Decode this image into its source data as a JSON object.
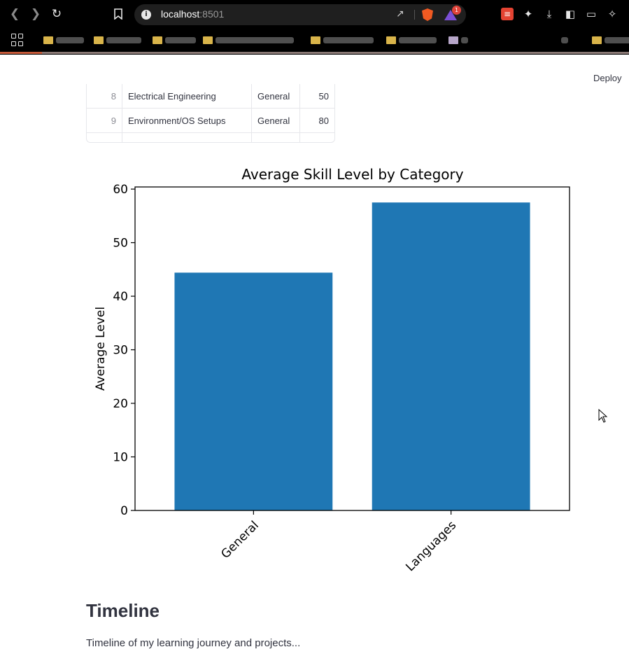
{
  "browser": {
    "url_host": "localhost",
    "url_port": ":8501",
    "notification_count": "1",
    "colors": {
      "chrome_bg": "#000000",
      "omnibox_bg": "#1f1f1f",
      "brave": "#f15a22",
      "todoist": "#e44332"
    }
  },
  "app": {
    "deploy_label": "Deploy"
  },
  "skills_table": {
    "rows": [
      {
        "index": "8",
        "skill": "Electrical Engineering",
        "category": "General",
        "level": "50"
      },
      {
        "index": "9",
        "skill": "Environment/OS Setups",
        "category": "General",
        "level": "80"
      }
    ]
  },
  "chart_data": {
    "type": "bar",
    "title": "Average Skill Level by Category",
    "xlabel": "",
    "ylabel": "Average Level",
    "categories": [
      "General",
      "Languages"
    ],
    "values": [
      44.4,
      57.5
    ],
    "ylim": [
      0,
      60.4
    ],
    "yticks": [
      0,
      10,
      20,
      30,
      40,
      50,
      60
    ],
    "bar_color": "#1f77b4",
    "grid": false,
    "x_tick_rotation": 45
  },
  "timeline": {
    "heading": "Timeline",
    "description": "Timeline of my learning journey and projects..."
  }
}
